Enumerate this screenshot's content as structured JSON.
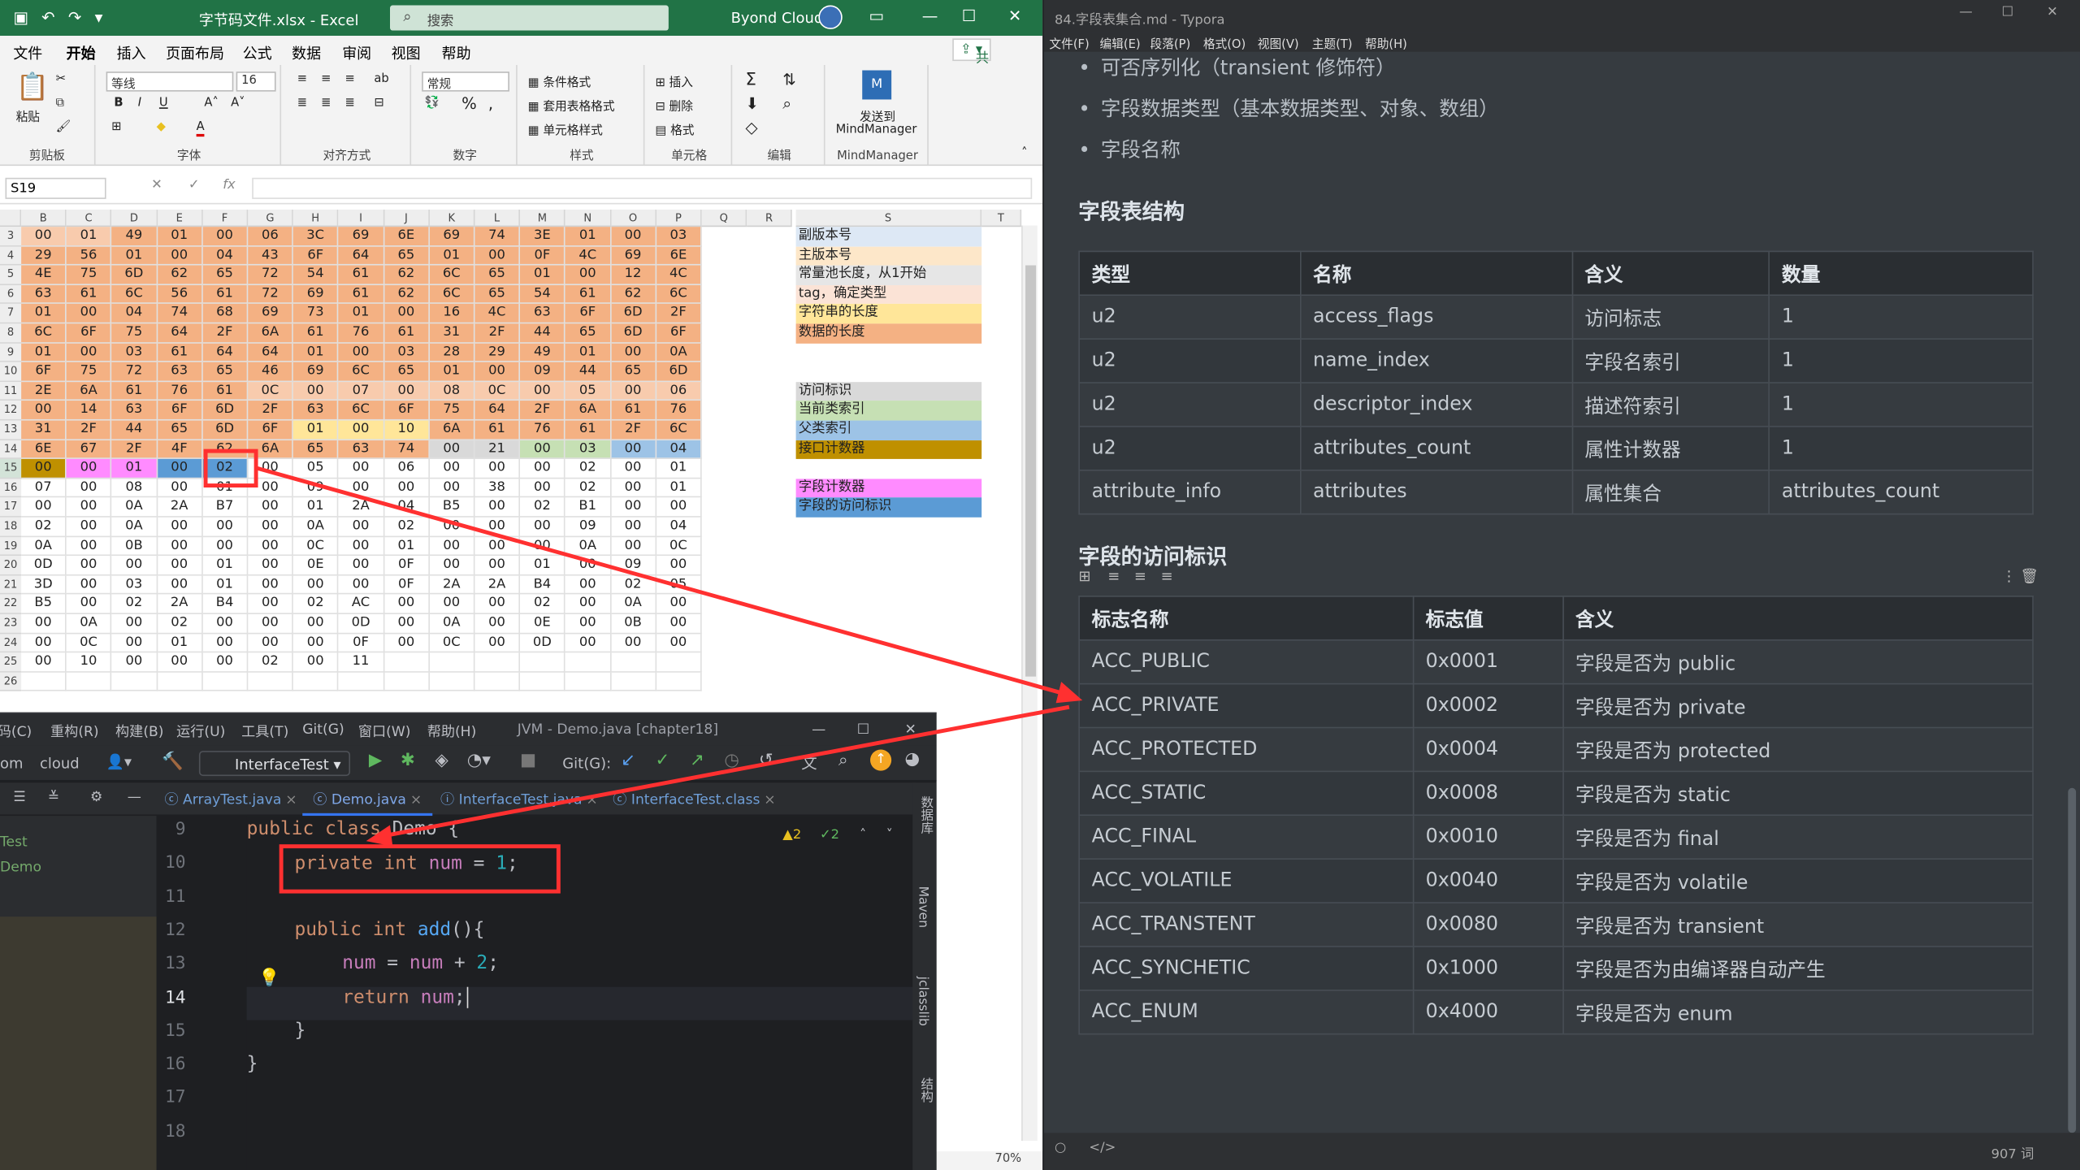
{
  "excel": {
    "file_name": "字节码文件.xlsx  -  Excel",
    "search_placeholder": "搜索",
    "user_name": "Byond Cloud",
    "tabs": [
      "文件",
      "开始",
      "插入",
      "页面布局",
      "公式",
      "数据",
      "审阅",
      "视图",
      "帮助"
    ],
    "share_label": "共享",
    "ribbon": {
      "paste": "粘贴",
      "clipboard": "剪贴板",
      "font_name": "等线",
      "font_size": "16",
      "font": "字体",
      "align": "对齐方式",
      "number_format": "常规",
      "number": "数字",
      "cond_format": "条件格式",
      "table_format": "套用表格格式",
      "cell_style": "单元格样式",
      "styles": "样式",
      "insert": "插入",
      "delete": "删除",
      "format": "格式",
      "cells": "单元格",
      "editing": "编辑",
      "send_to": "发送到",
      "mindmanager": "MindManager",
      "mindmanager_group": "MindManager"
    },
    "name_box": "S19",
    "fx": "fx",
    "columns": [
      "B",
      "C",
      "D",
      "E",
      "F",
      "G",
      "H",
      "I",
      "J",
      "K",
      "L",
      "M",
      "N",
      "O",
      "P",
      "Q",
      "R",
      "S",
      "T"
    ],
    "row_numbers": [
      3,
      4,
      5,
      6,
      7,
      8,
      9,
      10,
      11,
      12,
      13,
      14,
      15,
      16,
      17,
      18,
      19,
      20,
      21,
      22,
      23,
      24,
      25,
      26
    ],
    "rows": [
      [
        "00",
        "01",
        "49",
        "01",
        "00",
        "06",
        "3C",
        "69",
        "6E",
        "69",
        "74",
        "3E",
        "01",
        "00",
        "03"
      ],
      [
        "29",
        "56",
        "01",
        "00",
        "04",
        "43",
        "6F",
        "64",
        "65",
        "01",
        "00",
        "0F",
        "4C",
        "69",
        "6E"
      ],
      [
        "4E",
        "75",
        "6D",
        "62",
        "65",
        "72",
        "54",
        "61",
        "62",
        "6C",
        "65",
        "01",
        "00",
        "12",
        "4C"
      ],
      [
        "63",
        "61",
        "6C",
        "56",
        "61",
        "72",
        "69",
        "61",
        "62",
        "6C",
        "65",
        "54",
        "61",
        "62",
        "6C"
      ],
      [
        "01",
        "00",
        "04",
        "74",
        "68",
        "69",
        "73",
        "01",
        "00",
        "16",
        "4C",
        "63",
        "6F",
        "6D",
        "2F"
      ],
      [
        "6C",
        "6F",
        "75",
        "64",
        "2F",
        "6A",
        "61",
        "76",
        "61",
        "31",
        "2F",
        "44",
        "65",
        "6D",
        "6F"
      ],
      [
        "01",
        "00",
        "03",
        "61",
        "64",
        "64",
        "01",
        "00",
        "03",
        "28",
        "29",
        "49",
        "01",
        "00",
        "0A"
      ],
      [
        "6F",
        "75",
        "72",
        "63",
        "65",
        "46",
        "69",
        "6C",
        "65",
        "01",
        "00",
        "09",
        "44",
        "65",
        "6D"
      ],
      [
        "2E",
        "6A",
        "61",
        "76",
        "61",
        "0C",
        "00",
        "07",
        "00",
        "08",
        "0C",
        "00",
        "05",
        "00",
        "06"
      ],
      [
        "00",
        "14",
        "63",
        "6F",
        "6D",
        "2F",
        "63",
        "6C",
        "6F",
        "75",
        "64",
        "2F",
        "6A",
        "61",
        "76"
      ],
      [
        "31",
        "2F",
        "44",
        "65",
        "6D",
        "6F",
        "01",
        "00",
        "10",
        "6A",
        "61",
        "76",
        "61",
        "2F",
        "6C"
      ],
      [
        "6E",
        "67",
        "2F",
        "4F",
        "62",
        "6A",
        "65",
        "63",
        "74",
        "00",
        "21",
        "00",
        "03",
        "00",
        "04"
      ],
      [
        "00",
        "00",
        "01",
        "00",
        "02",
        "00",
        "05",
        "00",
        "06",
        "00",
        "00",
        "00",
        "02",
        "00",
        "01"
      ],
      [
        "07",
        "00",
        "08",
        "00",
        "01",
        "00",
        "09",
        "00",
        "00",
        "00",
        "38",
        "00",
        "02",
        "00",
        "01"
      ],
      [
        "00",
        "00",
        "0A",
        "2A",
        "B7",
        "00",
        "01",
        "2A",
        "04",
        "B5",
        "00",
        "02",
        "B1",
        "00",
        "00"
      ],
      [
        "02",
        "00",
        "0A",
        "00",
        "00",
        "00",
        "0A",
        "00",
        "02",
        "00",
        "00",
        "00",
        "09",
        "00",
        "04"
      ],
      [
        "0A",
        "00",
        "0B",
        "00",
        "00",
        "00",
        "0C",
        "00",
        "01",
        "00",
        "00",
        "00",
        "0A",
        "00",
        "0C"
      ],
      [
        "0D",
        "00",
        "00",
        "00",
        "01",
        "00",
        "0E",
        "00",
        "0F",
        "00",
        "00",
        "01",
        "00",
        "09",
        "00"
      ],
      [
        "3D",
        "00",
        "03",
        "00",
        "01",
        "00",
        "00",
        "00",
        "0F",
        "2A",
        "2A",
        "B4",
        "00",
        "02",
        "05"
      ],
      [
        "B5",
        "00",
        "02",
        "2A",
        "B4",
        "00",
        "02",
        "AC",
        "00",
        "00",
        "00",
        "02",
        "00",
        "0A",
        "00"
      ],
      [
        "00",
        "0A",
        "00",
        "02",
        "00",
        "00",
        "00",
        "0D",
        "00",
        "0A",
        "00",
        "0E",
        "00",
        "0B",
        "00"
      ],
      [
        "00",
        "0C",
        "00",
        "01",
        "00",
        "00",
        "00",
        "0F",
        "00",
        "0C",
        "00",
        "0D",
        "00",
        "00",
        "00"
      ],
      [
        "00",
        "10",
        "00",
        "00",
        "00",
        "02",
        "00",
        "11",
        "",
        "",
        "",
        "",
        "",
        "",
        ""
      ],
      [
        "",
        "",
        "",
        "",
        "",
        "",
        "",
        "",
        "",
        "",
        "",
        "",
        "",
        "",
        ""
      ]
    ],
    "legend": [
      {
        "label": "副版本号",
        "color": "#dde8f5"
      },
      {
        "label": "主版本号",
        "color": "#fde7c9"
      },
      {
        "label": "常量池长度，从1开始",
        "color": "#e6e6e6"
      },
      {
        "label": "tag，确定类型",
        "color": "#fbe3d6"
      },
      {
        "label": "字符串的长度",
        "color": "#ffe699"
      },
      {
        "label": "数据的长度",
        "color": "#f4b183"
      },
      {
        "label": "",
        "color": ""
      },
      {
        "label": "",
        "color": ""
      },
      {
        "label": "访问标识",
        "color": "#d9d9d9"
      },
      {
        "label": "当前类索引",
        "color": "#c6e0b4"
      },
      {
        "label": "父类索引",
        "color": "#9dc3e6"
      },
      {
        "label": "接口计数器",
        "color": "#bf9000"
      },
      {
        "label": "",
        "color": ""
      },
      {
        "label": "字段计数器",
        "color": "#ff8bff"
      },
      {
        "label": "字段的访问标识",
        "color": "#5b9bd5"
      }
    ],
    "zoom": "70%"
  },
  "ide": {
    "menu": [
      "码(C)",
      "重构(R)",
      "构建(B)",
      "运行(U)",
      "工具(T)",
      "Git(G)",
      "窗口(W)",
      "帮助(H)"
    ],
    "window_title": "JVM - Demo.java [chapter18]",
    "crumbs": [
      "om",
      "cloud"
    ],
    "run_config": "InterfaceTest",
    "git_label": "Git(G):",
    "tabs": [
      {
        "label": "ArrayTest.java",
        "active": false
      },
      {
        "label": "Demo.java",
        "active": true
      },
      {
        "label": "InterfaceTest.java",
        "active": false
      },
      {
        "label": "InterfaceTest.class",
        "active": false
      }
    ],
    "project_items": [
      "Test",
      "Demo"
    ],
    "line_numbers": [
      "9",
      "10",
      "11",
      "12",
      "13",
      "14",
      "15",
      "16",
      "17",
      "18"
    ],
    "warn_count": "2",
    "ok_count": "2",
    "right_panels": [
      "数据库",
      "Maven",
      "jclasslib",
      "结构"
    ],
    "code": {
      "l9_a": "public ",
      "l9_b": "class ",
      "l9_c": "Demo {",
      "l10_a": "private ",
      "l10_b": "int ",
      "l10_c": "num",
      " l10_d": " = ",
      "l10_e": "1",
      ";": ";",
      "l12_a": "public ",
      "l12_b": "int ",
      "l12_c": "add",
      "l12_d": "(){",
      "l13_a": "num",
      " l13_b": " = ",
      "l13_c": "num",
      "l13_d": " + ",
      "l13_e": "2",
      "l13_f": ";",
      "l14_a": "return ",
      "l14_b": "num",
      "l14_c": ";",
      "l15": "}",
      "l16": "}"
    }
  },
  "typora": {
    "title": "84.字段表集合.md - Typora",
    "menu": [
      "文件(F)",
      "编辑(E)",
      "段落(P)",
      "格式(O)",
      "视图(V)",
      "主题(T)",
      "帮助(H)"
    ],
    "bullets": [
      "可否序列化（transient 修饰符）",
      "字段数据类型（基本数据类型、对象、数组）",
      "字段名称"
    ],
    "h_struct": "字段表结构",
    "struct_table": {
      "headers": [
        "类型",
        "名称",
        "含义",
        "数量"
      ],
      "rows": [
        [
          "u2",
          "access_flags",
          "访问标志",
          "1"
        ],
        [
          "u2",
          "name_index",
          "字段名索引",
          "1"
        ],
        [
          "u2",
          "descriptor_index",
          "描述符索引",
          "1"
        ],
        [
          "u2",
          "attributes_count",
          "属性计数器",
          "1"
        ],
        [
          "attribute_info",
          "attributes",
          "属性集合",
          "attributes_count"
        ]
      ]
    },
    "h_flags": "字段的访问标识",
    "flags_table": {
      "headers": [
        "标志名称",
        "标志值",
        "含义"
      ],
      "rows": [
        [
          "ACC_PUBLIC",
          "0x0001",
          "字段是否为 public"
        ],
        [
          "ACC_PRIVATE",
          "0x0002",
          "字段是否为 private"
        ],
        [
          "ACC_PROTECTED",
          "0x0004",
          "字段是否为 protected"
        ],
        [
          "ACC_STATIC",
          "0x0008",
          "字段是否为 static"
        ],
        [
          "ACC_FINAL",
          "0x0010",
          "字段是否为 final"
        ],
        [
          "ACC_VOLATILE",
          "0x0040",
          "字段是否为 volatile"
        ],
        [
          "ACC_TRANSTENT",
          "0x0080",
          "字段是否为 transient"
        ],
        [
          "ACC_SYNCHETIC",
          "0x1000",
          "字段是否为由编译器自动产生"
        ],
        [
          "ACC_ENUM",
          "0x4000",
          "字段是否为 enum"
        ]
      ]
    },
    "word_count": "907 词",
    "status_icons": [
      "circle-icon",
      "code-icon"
    ]
  },
  "colors": {
    "excel_green": "#217346",
    "hex_orange": "#f4b183",
    "highlight_red": "#ff3030"
  }
}
